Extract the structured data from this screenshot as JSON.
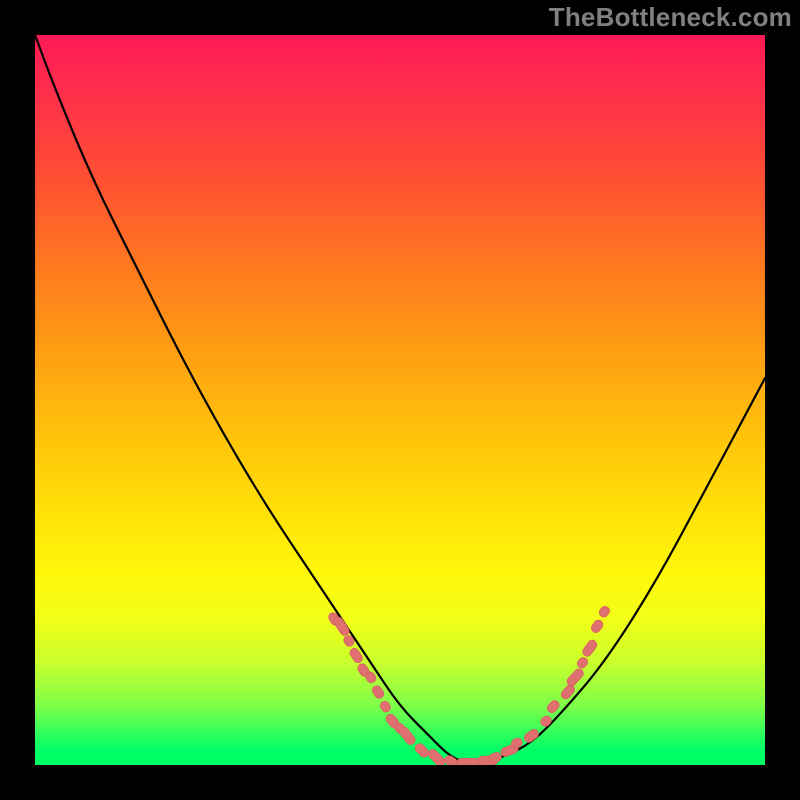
{
  "watermark": "TheBottleneck.com",
  "colors": {
    "frame_border": "#000000",
    "curve_stroke": "#000000",
    "marker_fill": "#e07070",
    "gradient_top": "#ff1a56",
    "gradient_bottom": "#00ff66"
  },
  "chart_data": {
    "type": "line",
    "title": "",
    "xlabel": "",
    "ylabel": "",
    "xlim": [
      0,
      100
    ],
    "ylim": [
      0,
      100
    ],
    "grid": false,
    "legend": false,
    "note": "Axes and ticks not shown; values estimated from pixel positions relative to plot area (0-100 normalized).",
    "series": [
      {
        "name": "bottleneck-curve",
        "x": [
          0,
          3,
          8,
          14,
          20,
          26,
          32,
          38,
          42,
          46,
          50,
          54,
          57,
          60,
          64,
          68,
          72,
          78,
          85,
          92,
          100
        ],
        "y": [
          100,
          92,
          80,
          68,
          56,
          45,
          35,
          26,
          20,
          14,
          8,
          4,
          1,
          0,
          1,
          3,
          7,
          14,
          25,
          38,
          53
        ]
      }
    ],
    "markers": [
      {
        "x": 41,
        "y": 20,
        "size": 6
      },
      {
        "x": 42,
        "y": 19,
        "size": 9
      },
      {
        "x": 43,
        "y": 17,
        "size": 5
      },
      {
        "x": 44,
        "y": 15,
        "size": 7
      },
      {
        "x": 45,
        "y": 13,
        "size": 6
      },
      {
        "x": 46,
        "y": 12,
        "size": 5
      },
      {
        "x": 47,
        "y": 10,
        "size": 6
      },
      {
        "x": 48,
        "y": 8,
        "size": 5
      },
      {
        "x": 49,
        "y": 6,
        "size": 7
      },
      {
        "x": 50,
        "y": 5,
        "size": 5
      },
      {
        "x": 51,
        "y": 4,
        "size": 9
      },
      {
        "x": 53,
        "y": 2,
        "size": 7
      },
      {
        "x": 55,
        "y": 1,
        "size": 9
      },
      {
        "x": 57,
        "y": 0.5,
        "size": 6
      },
      {
        "x": 59,
        "y": 0.3,
        "size": 8
      },
      {
        "x": 60,
        "y": 0.3,
        "size": 6
      },
      {
        "x": 62,
        "y": 0.6,
        "size": 9
      },
      {
        "x": 63,
        "y": 1,
        "size": 6
      },
      {
        "x": 65,
        "y": 2,
        "size": 8
      },
      {
        "x": 66,
        "y": 3,
        "size": 5
      },
      {
        "x": 68,
        "y": 4,
        "size": 7
      },
      {
        "x": 70,
        "y": 6,
        "size": 5
      },
      {
        "x": 71,
        "y": 8,
        "size": 6
      },
      {
        "x": 73,
        "y": 10,
        "size": 7
      },
      {
        "x": 74,
        "y": 12,
        "size": 9
      },
      {
        "x": 75,
        "y": 14,
        "size": 5
      },
      {
        "x": 76,
        "y": 16,
        "size": 8
      },
      {
        "x": 77,
        "y": 19,
        "size": 6
      },
      {
        "x": 78,
        "y": 21,
        "size": 5
      }
    ]
  }
}
